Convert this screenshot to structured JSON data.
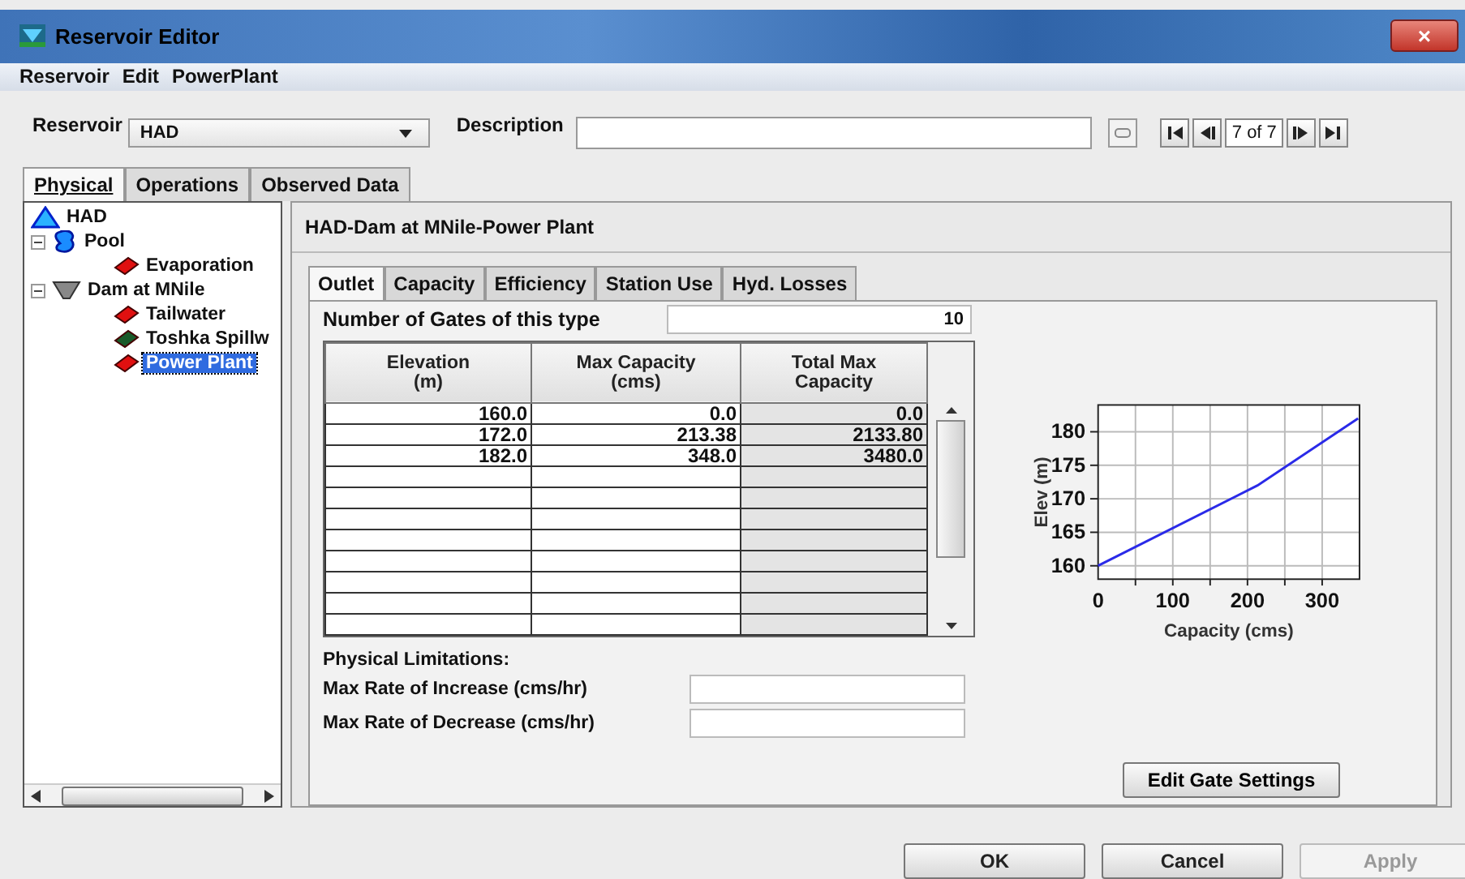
{
  "window": {
    "title": "Reservoir Editor",
    "close": "×"
  },
  "menu": [
    "Reservoir",
    "Edit",
    "PowerPlant"
  ],
  "toolbar": {
    "reservoir_label": "Reservoir",
    "reservoir_value": "HAD",
    "description_label": "Description",
    "record": "7 of 7"
  },
  "tabs": [
    {
      "label": "Physical",
      "selected": true
    },
    {
      "label": "Operations",
      "selected": false
    },
    {
      "label": "Observed Data",
      "selected": false
    }
  ],
  "tree": [
    {
      "label": "HAD",
      "kind": "reservoir",
      "selected": false,
      "children": [
        {
          "label": "Pool",
          "kind": "pool",
          "selected": false,
          "expanded": true,
          "children": [
            {
              "label": "Evaporation",
              "kind": "method-red",
              "selected": false
            }
          ]
        },
        {
          "label": "Dam at MNile",
          "kind": "dam",
          "selected": false,
          "expanded": true,
          "children": [
            {
              "label": "Tailwater",
              "kind": "method-red",
              "selected": false
            },
            {
              "label": "Toshka Spillw",
              "kind": "method-green",
              "selected": false
            },
            {
              "label": "Power Plant",
              "kind": "method-red",
              "selected": true
            }
          ]
        }
      ]
    }
  ],
  "panel": {
    "title": "HAD-Dam at MNile-Power Plant",
    "tabs": [
      {
        "label": "Outlet",
        "selected": true
      },
      {
        "label": "Capacity",
        "selected": false
      },
      {
        "label": "Efficiency",
        "selected": false
      },
      {
        "label": "Station Use",
        "selected": false
      },
      {
        "label": "Hyd. Losses",
        "selected": false
      }
    ],
    "gates_label": "Number of Gates of this type",
    "gates_value": "10",
    "table": {
      "columns": [
        "Elevation\n(m)",
        "Max Capacity\n(cms)",
        "Total Max\nCapacity"
      ],
      "rows": [
        [
          "160.0",
          "0.0",
          "0.0"
        ],
        [
          "172.0",
          "213.38",
          "2133.80"
        ],
        [
          "182.0",
          "348.0",
          "3480.0"
        ]
      ]
    },
    "limits_title": "Physical Limitations:",
    "limits": [
      {
        "label": "Max Rate of Increase (cms/hr)"
      },
      {
        "label": "Max Rate of Decrease (cms/hr)"
      }
    ],
    "edit_button": "Edit Gate Settings",
    "chart_data": {
      "type": "line",
      "xlabel": "Capacity (cms)",
      "ylabel": "Elev (m)",
      "xlim": [
        0,
        350
      ],
      "ylim": [
        158,
        184
      ],
      "xticks": [
        0,
        100,
        200,
        300
      ],
      "yticks": [
        160,
        165,
        170,
        175,
        180
      ],
      "grid": true,
      "series": [
        {
          "color": "#2a2ae8",
          "x": [
            0,
            213.38,
            348
          ],
          "values": [
            160,
            172,
            182
          ]
        }
      ]
    }
  },
  "buttons": [
    {
      "label": "OK",
      "disabled": false
    },
    {
      "label": "Cancel",
      "disabled": false
    },
    {
      "label": "Apply",
      "disabled": true
    }
  ]
}
